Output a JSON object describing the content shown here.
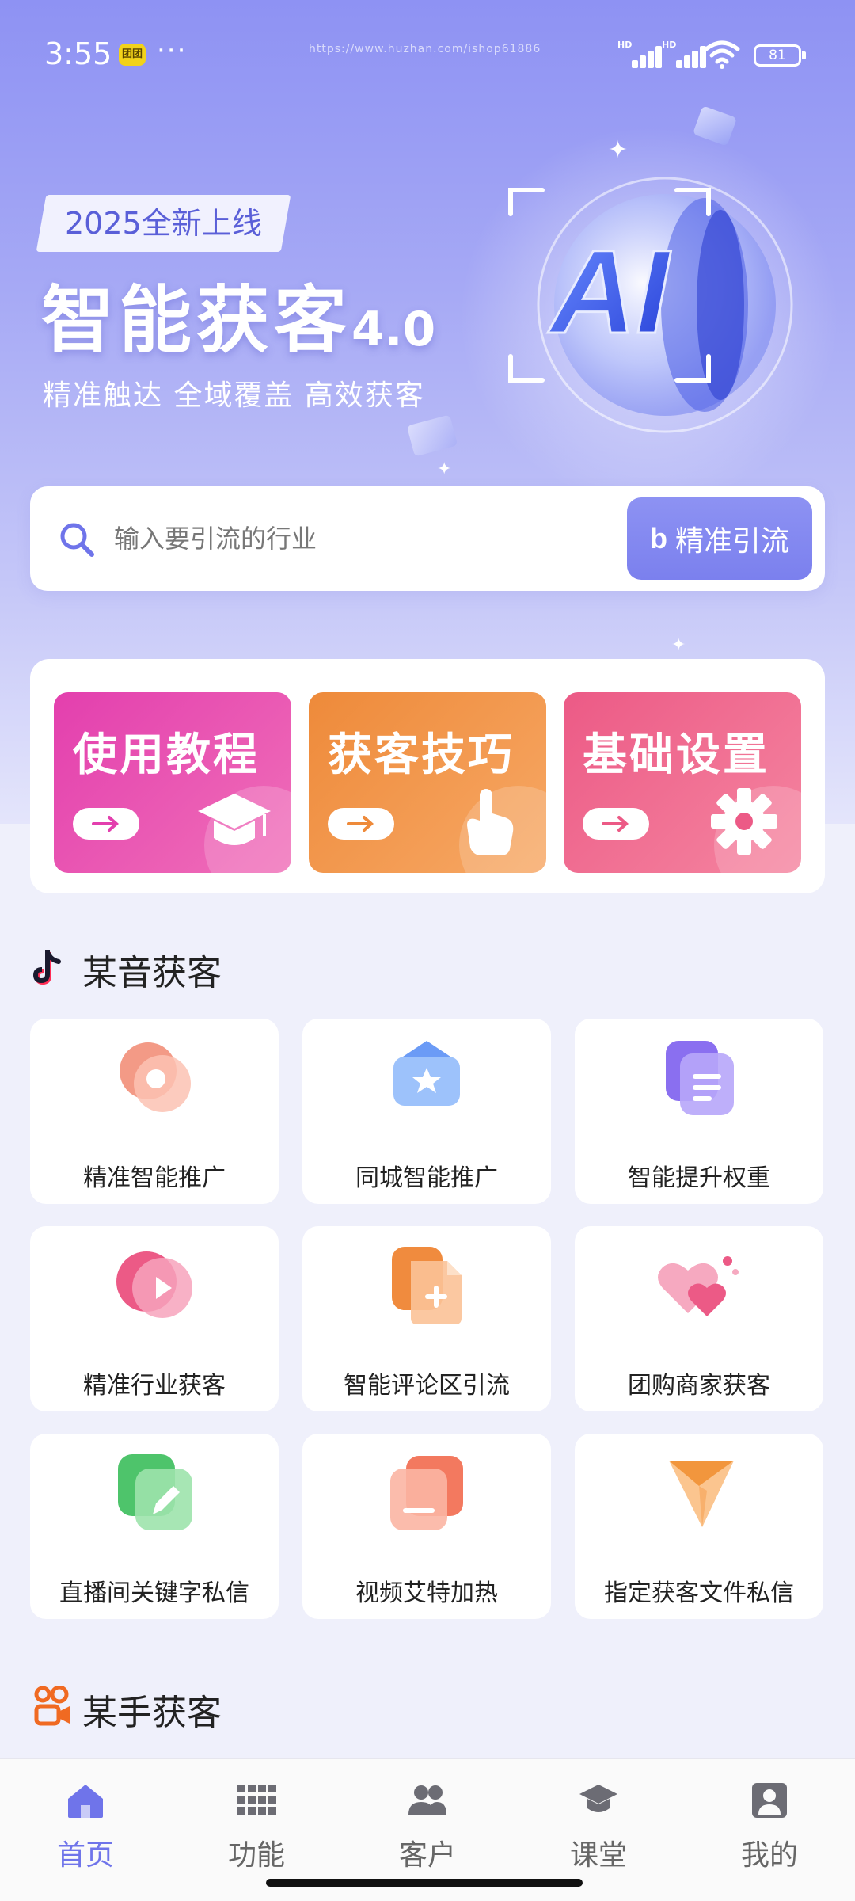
{
  "status_bar": {
    "time": "3:55",
    "app_icon_text": "团团",
    "dots": "···",
    "watermark": "https://www.huzhan.com/ishop61886",
    "battery": "81"
  },
  "hero": {
    "tag": "2025全新上线",
    "title": "智能获客",
    "version": "4.0",
    "subtitle": "精准触达 全域覆盖 高效获客",
    "art_text": "AI"
  },
  "search": {
    "placeholder": "输入要引流的行业",
    "button_label": "精准引流",
    "button_logo": "b"
  },
  "quick_cards": [
    {
      "label": "使用教程",
      "icon": "graduation-cap-icon",
      "colors": [
        "#e33fae",
        "#f06fb8"
      ]
    },
    {
      "label": "获客技巧",
      "icon": "tap-hand-icon",
      "colors": [
        "#ee8a3a",
        "#f7a865"
      ]
    },
    {
      "label": "基础设置",
      "icon": "gear-icon",
      "colors": [
        "#ec5a86",
        "#f585a0"
      ]
    }
  ],
  "section_douyin": {
    "title": "某音获客",
    "items": [
      {
        "label": "精准智能推广",
        "icon": "target-icon"
      },
      {
        "label": "同城智能推广",
        "icon": "ticket-star-icon"
      },
      {
        "label": "智能提升权重",
        "icon": "document-stack-icon"
      },
      {
        "label": "精准行业获客",
        "icon": "play-circle-icon"
      },
      {
        "label": "智能评论区引流",
        "icon": "add-file-icon"
      },
      {
        "label": "团购商家获客",
        "icon": "hearts-icon"
      },
      {
        "label": "直播间关键字私信",
        "icon": "edit-card-icon"
      },
      {
        "label": "视频艾特加热",
        "icon": "card-minus-icon"
      },
      {
        "label": "指定获客文件私信",
        "icon": "paper-plane-icon"
      }
    ]
  },
  "section_kuaishou": {
    "title": "某手获客"
  },
  "bottom_nav": [
    {
      "label": "首页",
      "icon": "home-icon",
      "active": true
    },
    {
      "label": "功能",
      "icon": "grid-icon",
      "active": false
    },
    {
      "label": "客户",
      "icon": "users-icon",
      "active": false
    },
    {
      "label": "课堂",
      "icon": "graduation-cap-icon",
      "active": false
    },
    {
      "label": "我的",
      "icon": "profile-icon",
      "active": false
    }
  ],
  "colors": {
    "accent": "#6f74ea",
    "hero_bg": "#8e92f3"
  }
}
